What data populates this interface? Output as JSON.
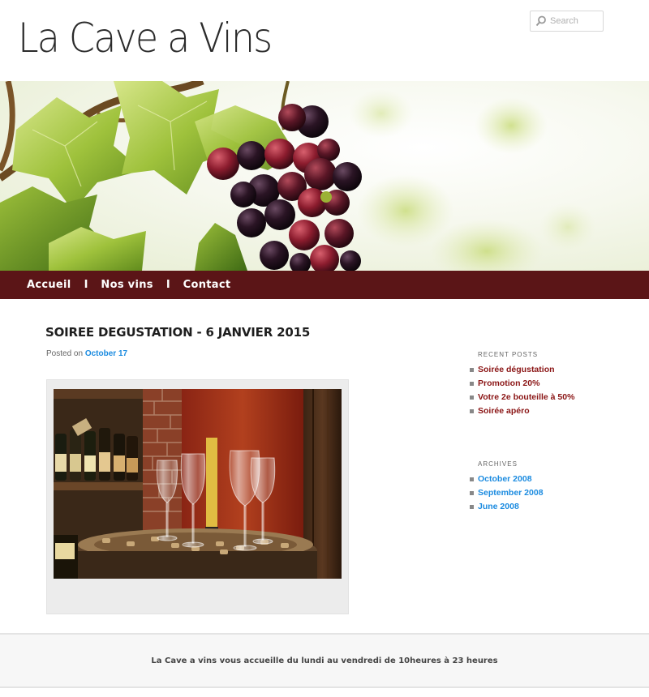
{
  "site": {
    "title": "La Cave a Vins"
  },
  "search": {
    "placeholder": "Search"
  },
  "nav": {
    "items": [
      {
        "label": "Accueil"
      },
      {
        "label": "Nos vins"
      },
      {
        "label": "Contact"
      }
    ],
    "separator": "I"
  },
  "post": {
    "title": "SOIREE DEGUSTATION - 6 JANVIER 2015",
    "posted_on_label": "Posted on",
    "date": "October 17"
  },
  "sidebar": {
    "recent_title": "RECENT POSTS",
    "recent_posts": [
      "Soirée dégustation",
      "Promotion 20%",
      "Votre 2e bouteille à 50%",
      "Soirée apéro"
    ],
    "archives_title": "ARCHIVES",
    "archives": [
      "October 2008",
      "September 2008",
      "June 2008"
    ]
  },
  "footer": {
    "text": "La Cave a vins vous accueille du lundi au vendredi de 10heures à 23 heures"
  },
  "colors": {
    "nav_background": "#5b1517",
    "recent_link": "#8a1414",
    "archive_link": "#1b8be0"
  },
  "icons": {
    "search": "magnifier-icon"
  }
}
